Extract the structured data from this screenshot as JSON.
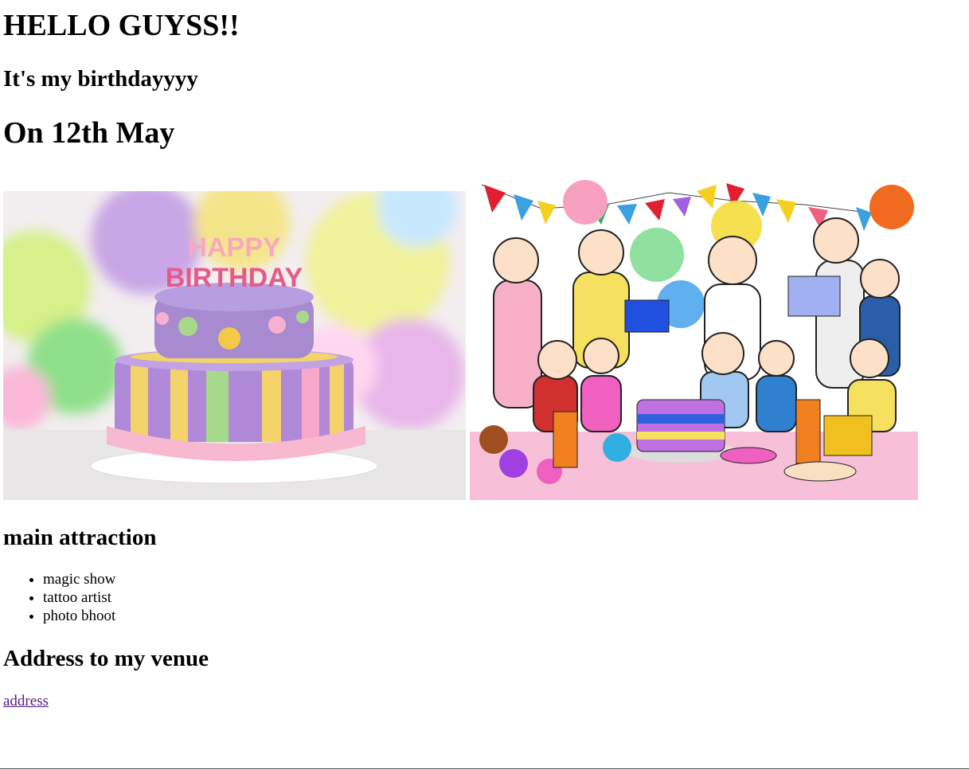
{
  "page": {
    "greeting": "HELLO GUYSS!!",
    "subtitle": "It's my birthdayyyy",
    "date": "On 12th May"
  },
  "images": {
    "cake_text": "HAPPY BIRTHDAY"
  },
  "attractions": {
    "heading": "main attraction",
    "items": [
      "magic show",
      "tattoo artist",
      "photo bhoot"
    ]
  },
  "venue": {
    "heading": "Address to my venue",
    "link_label": "address"
  }
}
